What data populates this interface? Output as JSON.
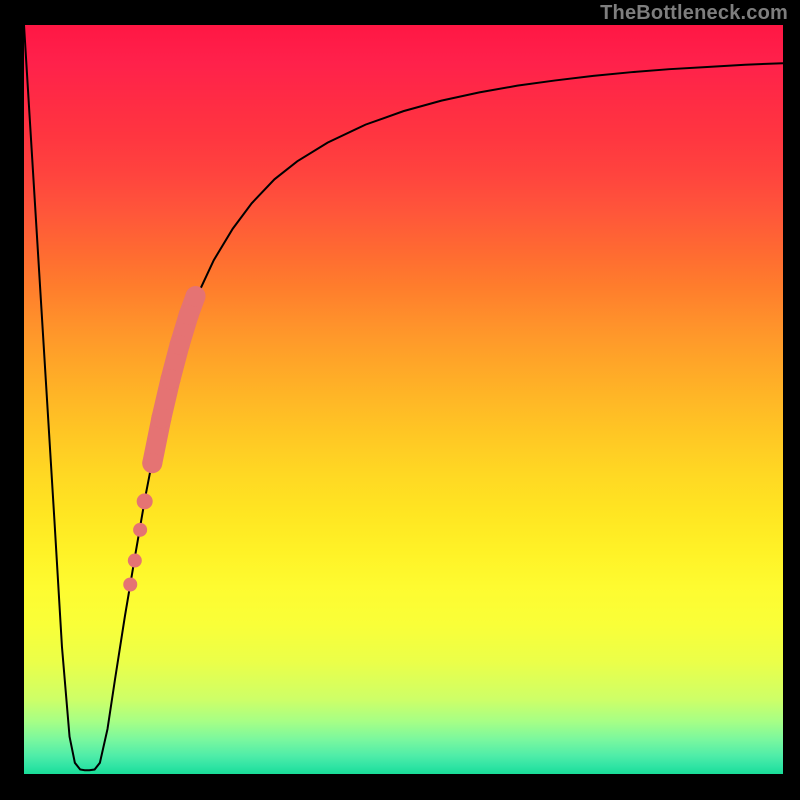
{
  "watermark": {
    "text": "TheBottleneck.com"
  },
  "chart_data": {
    "type": "line",
    "title": "",
    "xlabel": "",
    "ylabel": "",
    "xlim": [
      0,
      100
    ],
    "ylim": [
      0,
      100
    ],
    "grid": false,
    "legend": false,
    "background_gradient": {
      "direction": "vertical",
      "stops": [
        {
          "pos": 0.0,
          "color": "#FF1744"
        },
        {
          "pos": 0.05,
          "color": "#FF214B"
        },
        {
          "pos": 0.103,
          "color": "#FF2C44"
        },
        {
          "pos": 0.15,
          "color": "#FF3640"
        },
        {
          "pos": 0.2,
          "color": "#FF443E"
        },
        {
          "pos": 0.25,
          "color": "#FF563A"
        },
        {
          "pos": 0.3,
          "color": "#FF6932"
        },
        {
          "pos": 0.35,
          "color": "#FF7D2C"
        },
        {
          "pos": 0.4,
          "color": "#FF922B"
        },
        {
          "pos": 0.45,
          "color": "#FFA528"
        },
        {
          "pos": 0.5,
          "color": "#FFB726"
        },
        {
          "pos": 0.55,
          "color": "#FFC824"
        },
        {
          "pos": 0.6,
          "color": "#FFD823"
        },
        {
          "pos": 0.65,
          "color": "#FFE522"
        },
        {
          "pos": 0.7,
          "color": "#FFF126"
        },
        {
          "pos": 0.75,
          "color": "#FEFB30"
        },
        {
          "pos": 0.8,
          "color": "#F9FF38"
        },
        {
          "pos": 0.85,
          "color": "#EBFF49"
        },
        {
          "pos": 0.9,
          "color": "#CEFF67"
        },
        {
          "pos": 0.93,
          "color": "#A6FF86"
        },
        {
          "pos": 0.955,
          "color": "#78F79F"
        },
        {
          "pos": 0.975,
          "color": "#50EDA8"
        },
        {
          "pos": 0.99,
          "color": "#2FE4A4"
        },
        {
          "pos": 1.0,
          "color": "#18DD97"
        }
      ]
    },
    "series": [
      {
        "name": "curve",
        "color": "#000000",
        "stroke_width": 2,
        "x": [
          0.0,
          2.0,
          4.0,
          5.0,
          6.0,
          6.7,
          7.4,
          8.0,
          8.6,
          9.3,
          10.0,
          11.0,
          12.0,
          13.3,
          14.7,
          16.0,
          17.3,
          18.7,
          20.0,
          21.3,
          22.7,
          25.0,
          27.5,
          30.0,
          33.0,
          36.0,
          40.0,
          45.0,
          50.0,
          55.0,
          60.0,
          65.0,
          70.0,
          75.0,
          80.0,
          85.0,
          90.0,
          95.0,
          100.0
        ],
        "y": [
          100.0,
          67.0,
          34.0,
          17.0,
          5.0,
          1.5,
          0.6,
          0.5,
          0.5,
          0.6,
          1.5,
          6.0,
          12.7,
          21.1,
          29.5,
          37.1,
          43.9,
          50.0,
          55.3,
          59.8,
          63.6,
          68.6,
          72.8,
          76.2,
          79.4,
          81.8,
          84.3,
          86.7,
          88.5,
          89.9,
          91.0,
          91.9,
          92.6,
          93.2,
          93.7,
          94.1,
          94.4,
          94.7,
          94.9
        ]
      }
    ],
    "scatter_points": {
      "name": "highlighted-segment",
      "color": "#E57373",
      "points": [
        {
          "x": 14.0,
          "y": 25.3,
          "size": 7
        },
        {
          "x": 14.6,
          "y": 28.5,
          "size": 7
        },
        {
          "x": 15.3,
          "y": 32.6,
          "size": 7
        },
        {
          "x": 15.9,
          "y": 36.4,
          "size": 8
        },
        {
          "x": 16.9,
          "y": 41.5,
          "size": 10,
          "stretch": true
        },
        {
          "x": 18.1,
          "y": 47.5,
          "size": 10,
          "stretch": true
        },
        {
          "x": 19.3,
          "y": 52.7,
          "size": 10,
          "stretch": true
        },
        {
          "x": 20.5,
          "y": 57.3,
          "size": 10,
          "stretch": true
        },
        {
          "x": 21.7,
          "y": 61.3,
          "size": 10,
          "stretch": true
        },
        {
          "x": 22.6,
          "y": 63.8,
          "size": 10,
          "stretch": true
        }
      ]
    },
    "frame": {
      "inset_left": 24,
      "inset_right": 17,
      "inset_top": 25,
      "inset_bottom": 26,
      "border_color": "#000000"
    }
  }
}
